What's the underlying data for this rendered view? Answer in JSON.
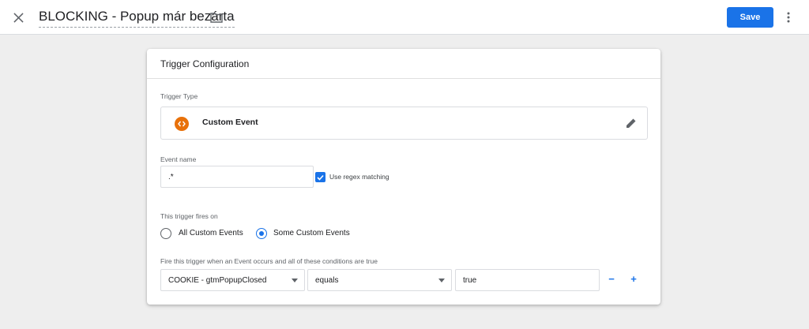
{
  "header": {
    "title": "BLOCKING - Popup már bezárta",
    "save_label": "Save"
  },
  "card": {
    "title": "Trigger Configuration",
    "trigger_type_label": "Trigger Type",
    "trigger_type_name": "Custom Event",
    "event_name_label": "Event name",
    "event_name_value": ".*",
    "regex_label": "Use regex matching",
    "regex_checked": true,
    "fires_on_label": "This trigger fires on",
    "fires_on_options": [
      "All Custom Events",
      "Some Custom Events"
    ],
    "fires_on_selected": "Some Custom Events",
    "condition_label": "Fire this trigger when an Event occurs and all of these conditions are true",
    "condition": {
      "variable": "COOKIE - gtmPopupClosed",
      "operator": "equals",
      "value": "true"
    },
    "remove_label": "−",
    "add_label": "+"
  },
  "colors": {
    "accent": "#1a73e8",
    "custom_event_icon": "#e8710a",
    "background": "#eeeeee"
  },
  "icons": [
    "close-icon",
    "folder-icon",
    "more-vert-icon",
    "custom-event-icon",
    "edit-pencil-icon",
    "check-icon"
  ]
}
